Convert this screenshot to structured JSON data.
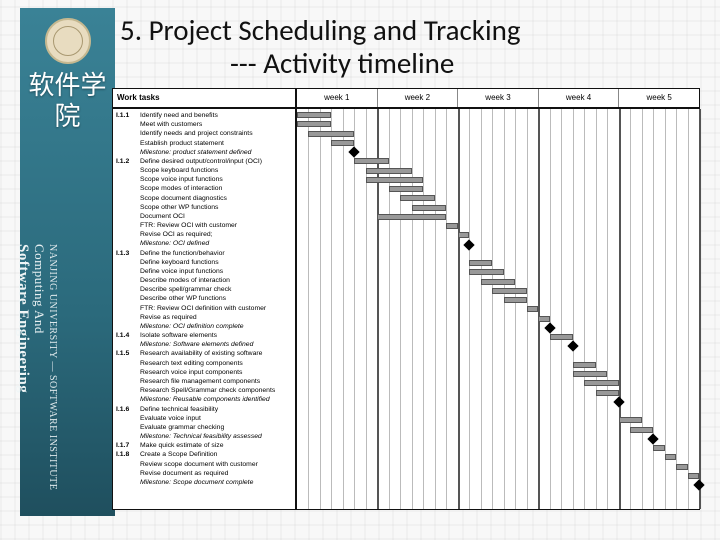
{
  "slide": {
    "title_line1": "5. Project Scheduling and Tracking",
    "title_line2": "--- Activity timeline"
  },
  "sidebar": {
    "cn_text": "软件学院",
    "en_line1": "NANJING UNIVERSITY — SOFTWARE INSTITUTE",
    "en_line2": "Computing And",
    "en_line3": "Software Engineering"
  },
  "chart": {
    "task_header": "Work tasks",
    "weeks": [
      "week 1",
      "week 2",
      "week 3",
      "week 4",
      "week 5"
    ],
    "tasks": [
      {
        "id": "I.1.1",
        "name": "Identify need and benefits",
        "bar": {
          "xd": 0,
          "wd": 3
        }
      },
      {
        "id": "",
        "name": "Meet with customers",
        "bar": {
          "xd": 0,
          "wd": 3
        }
      },
      {
        "id": "",
        "name": "Identify needs and project constraints",
        "bar": {
          "xd": 1,
          "wd": 4
        }
      },
      {
        "id": "",
        "name": "Establish product statement",
        "bar": {
          "xd": 3,
          "wd": 2
        }
      },
      {
        "id": "",
        "name": "Milestone: product statement defined",
        "italic": true,
        "ms": 5
      },
      {
        "id": "I.1.2",
        "name": "Define desired output/control/input (OCI)",
        "bar": {
          "xd": 5,
          "wd": 3
        }
      },
      {
        "id": "",
        "name": "Scope keyboard functions",
        "bar": {
          "xd": 6,
          "wd": 4
        }
      },
      {
        "id": "",
        "name": "Scope voice input functions",
        "bar": {
          "xd": 6,
          "wd": 5
        }
      },
      {
        "id": "",
        "name": "Scope modes of interaction",
        "bar": {
          "xd": 8,
          "wd": 3
        }
      },
      {
        "id": "",
        "name": "Scope document diagnostics",
        "bar": {
          "xd": 9,
          "wd": 3
        }
      },
      {
        "id": "",
        "name": "Scope other WP functions",
        "bar": {
          "xd": 10,
          "wd": 3
        }
      },
      {
        "id": "",
        "name": "Document OCI",
        "bar": {
          "xd": 7,
          "wd": 6
        }
      },
      {
        "id": "",
        "name": "FTR: Review OCI with customer",
        "bar": {
          "xd": 13,
          "wd": 1
        }
      },
      {
        "id": "",
        "name": "Revise OCI as required;",
        "bar": {
          "xd": 14,
          "wd": 1
        }
      },
      {
        "id": "",
        "name": "Milestone: OCI defined",
        "italic": true,
        "ms": 15
      },
      {
        "id": "I.1.3",
        "name": "Define the function/behavior"
      },
      {
        "id": "",
        "name": "Define keyboard functions",
        "bar": {
          "xd": 15,
          "wd": 2
        }
      },
      {
        "id": "",
        "name": "Define voice input functions",
        "bar": {
          "xd": 15,
          "wd": 3
        }
      },
      {
        "id": "",
        "name": "Describe modes of interaction",
        "bar": {
          "xd": 16,
          "wd": 3
        }
      },
      {
        "id": "",
        "name": "Describe spell/grammar check",
        "bar": {
          "xd": 17,
          "wd": 3
        }
      },
      {
        "id": "",
        "name": "Describe other WP functions",
        "bar": {
          "xd": 18,
          "wd": 2
        }
      },
      {
        "id": "",
        "name": "FTR: Review OCI definition with customer",
        "bar": {
          "xd": 20,
          "wd": 1
        }
      },
      {
        "id": "",
        "name": "Revise as required",
        "bar": {
          "xd": 21,
          "wd": 1
        }
      },
      {
        "id": "",
        "name": "Milestone: OCI definition complete",
        "italic": true,
        "ms": 22
      },
      {
        "id": "I.1.4",
        "name": "Isolate software elements",
        "bar": {
          "xd": 22,
          "wd": 2
        }
      },
      {
        "id": "",
        "name": "Milestone: Software elements defined",
        "italic": true,
        "ms": 24
      },
      {
        "id": "I.1.5",
        "name": "Research availability of existing software"
      },
      {
        "id": "",
        "name": "Research text editing components",
        "bar": {
          "xd": 24,
          "wd": 2
        }
      },
      {
        "id": "",
        "name": "Research voice input components",
        "bar": {
          "xd": 24,
          "wd": 3
        }
      },
      {
        "id": "",
        "name": "Research file management components",
        "bar": {
          "xd": 25,
          "wd": 3
        }
      },
      {
        "id": "",
        "name": "Research Spell/Grammar check components",
        "bar": {
          "xd": 26,
          "wd": 2
        }
      },
      {
        "id": "",
        "name": "Milestone: Reusable components identified",
        "italic": true,
        "ms": 28
      },
      {
        "id": "I.1.6",
        "name": "Define technical feasibility"
      },
      {
        "id": "",
        "name": "Evaluate voice input",
        "bar": {
          "xd": 28,
          "wd": 2
        }
      },
      {
        "id": "",
        "name": "Evaluate grammar checking",
        "bar": {
          "xd": 29,
          "wd": 2
        }
      },
      {
        "id": "",
        "name": "Milestone: Technical feasibility assessed",
        "italic": true,
        "ms": 31
      },
      {
        "id": "I.1.7",
        "name": "Make quick estimate of size",
        "bar": {
          "xd": 31,
          "wd": 1
        }
      },
      {
        "id": "I.1.8",
        "name": "Create a Scope Definition",
        "bar": {
          "xd": 32,
          "wd": 1
        }
      },
      {
        "id": "",
        "name": "Review scope document with customer",
        "bar": {
          "xd": 33,
          "wd": 1
        }
      },
      {
        "id": "",
        "name": "Revise document as required",
        "bar": {
          "xd": 34,
          "wd": 1
        }
      },
      {
        "id": "",
        "name": "Milestone: Scope document complete",
        "italic": true,
        "ms": 35
      }
    ]
  },
  "chart_data": {
    "type": "gantt",
    "title": "Activity timeline",
    "x_unit": "days",
    "weeks": 5,
    "days_per_week": 7,
    "xlim": [
      0,
      35
    ],
    "series": [
      {
        "id": "I.1.1",
        "name": "Identify need and benefits",
        "start": 0,
        "duration": 3
      },
      {
        "name": "Meet with customers",
        "start": 0,
        "duration": 3
      },
      {
        "name": "Identify needs and project constraints",
        "start": 1,
        "duration": 4
      },
      {
        "name": "Establish product statement",
        "start": 3,
        "duration": 2
      },
      {
        "name": "Milestone: product statement defined",
        "milestone": 5
      },
      {
        "id": "I.1.2",
        "name": "Define desired output/control/input (OCI)",
        "start": 5,
        "duration": 3
      },
      {
        "name": "Scope keyboard functions",
        "start": 6,
        "duration": 4
      },
      {
        "name": "Scope voice input functions",
        "start": 6,
        "duration": 5
      },
      {
        "name": "Scope modes of interaction",
        "start": 8,
        "duration": 3
      },
      {
        "name": "Scope document diagnostics",
        "start": 9,
        "duration": 3
      },
      {
        "name": "Scope other WP functions",
        "start": 10,
        "duration": 3
      },
      {
        "name": "Document OCI",
        "start": 7,
        "duration": 6
      },
      {
        "name": "FTR: Review OCI with customer",
        "start": 13,
        "duration": 1
      },
      {
        "name": "Revise OCI as required",
        "start": 14,
        "duration": 1
      },
      {
        "name": "Milestone: OCI defined",
        "milestone": 15
      },
      {
        "id": "I.1.3",
        "name": "Define the function/behavior"
      },
      {
        "name": "Define keyboard functions",
        "start": 15,
        "duration": 2
      },
      {
        "name": "Define voice input functions",
        "start": 15,
        "duration": 3
      },
      {
        "name": "Describe modes of interaction",
        "start": 16,
        "duration": 3
      },
      {
        "name": "Describe spell/grammar check",
        "start": 17,
        "duration": 3
      },
      {
        "name": "Describe other WP functions",
        "start": 18,
        "duration": 2
      },
      {
        "name": "FTR: Review OCI definition with customer",
        "start": 20,
        "duration": 1
      },
      {
        "name": "Revise as required",
        "start": 21,
        "duration": 1
      },
      {
        "name": "Milestone: OCI definition complete",
        "milestone": 22
      },
      {
        "id": "I.1.4",
        "name": "Isolate software elements",
        "start": 22,
        "duration": 2
      },
      {
        "name": "Milestone: Software elements defined",
        "milestone": 24
      },
      {
        "id": "I.1.5",
        "name": "Research availability of existing software"
      },
      {
        "name": "Research text editing components",
        "start": 24,
        "duration": 2
      },
      {
        "name": "Research voice input components",
        "start": 24,
        "duration": 3
      },
      {
        "name": "Research file management components",
        "start": 25,
        "duration": 3
      },
      {
        "name": "Research Spell/Grammar check components",
        "start": 26,
        "duration": 2
      },
      {
        "name": "Milestone: Reusable components identified",
        "milestone": 28
      },
      {
        "id": "I.1.6",
        "name": "Define technical feasibility"
      },
      {
        "name": "Evaluate voice input",
        "start": 28,
        "duration": 2
      },
      {
        "name": "Evaluate grammar checking",
        "start": 29,
        "duration": 2
      },
      {
        "name": "Milestone: Technical feasibility assessed",
        "milestone": 31
      },
      {
        "id": "I.1.7",
        "name": "Make quick estimate of size",
        "start": 31,
        "duration": 1
      },
      {
        "id": "I.1.8",
        "name": "Create a Scope Definition",
        "start": 32,
        "duration": 1
      },
      {
        "name": "Review scope document with customer",
        "start": 33,
        "duration": 1
      },
      {
        "name": "Revise document as required",
        "start": 34,
        "duration": 1
      },
      {
        "name": "Milestone: Scope document complete",
        "milestone": 35
      }
    ]
  }
}
